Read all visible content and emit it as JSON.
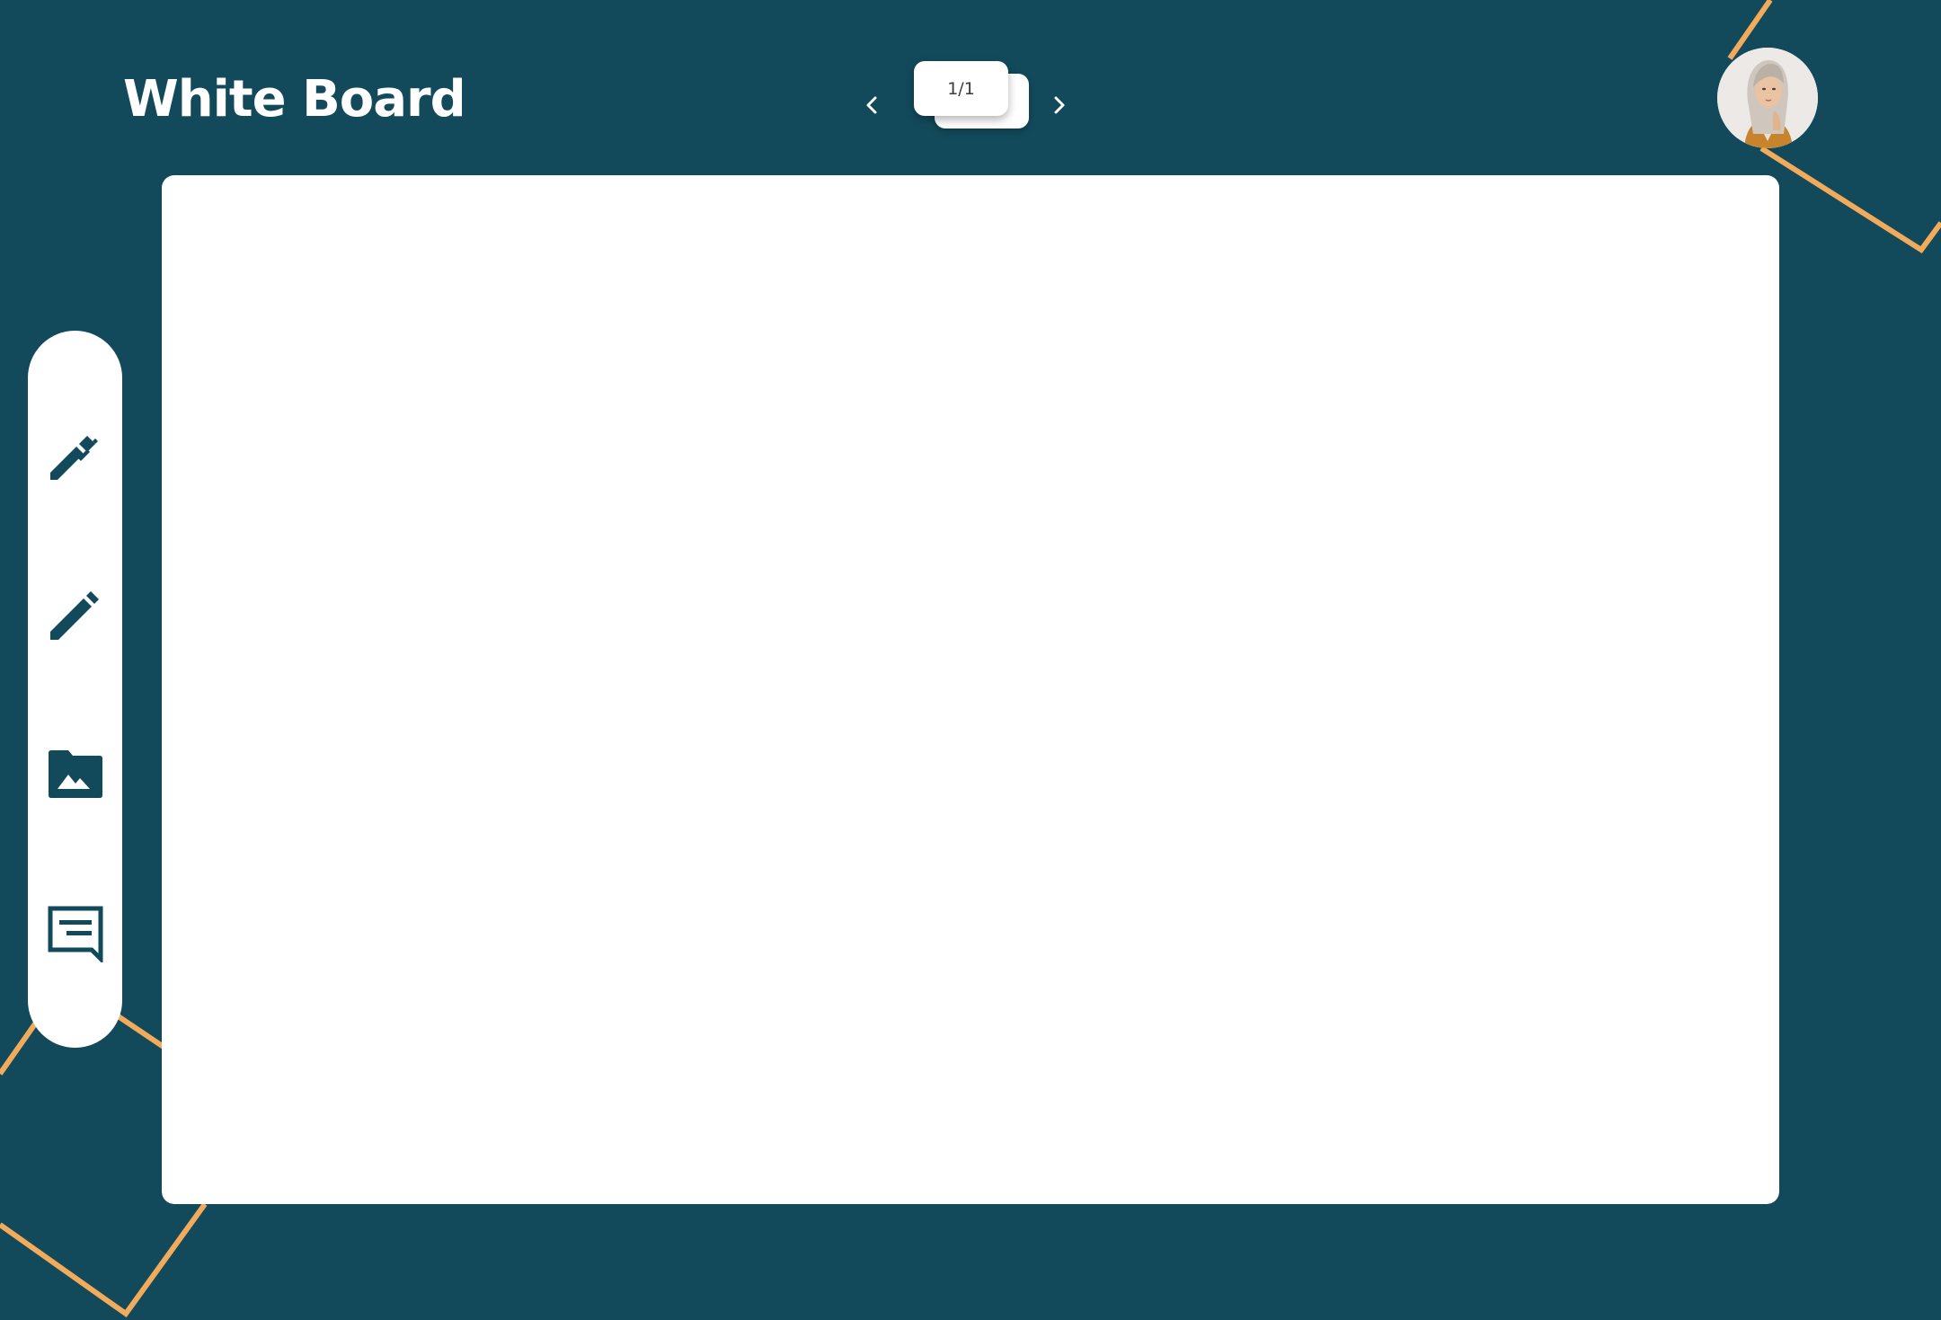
{
  "app": {
    "title": "White Board"
  },
  "pager": {
    "current": "1/1",
    "prev_icon": "chevron-left-icon",
    "next_icon": "chevron-right-icon"
  },
  "user": {
    "avatar_icon": "user-avatar"
  },
  "toolbar": {
    "tools": [
      {
        "name": "marker",
        "icon": "marker-icon"
      },
      {
        "name": "pencil",
        "icon": "pencil-icon"
      },
      {
        "name": "image-folder",
        "icon": "image-folder-icon"
      },
      {
        "name": "comment",
        "icon": "comment-icon"
      }
    ]
  },
  "colors": {
    "background": "#124a5c",
    "accent_lines": "#f2ab5b",
    "board": "#ffffff",
    "icon": "#124a5c"
  }
}
